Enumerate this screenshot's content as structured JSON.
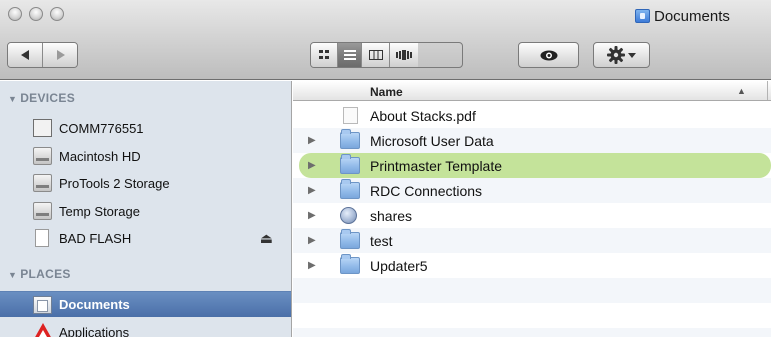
{
  "window": {
    "title": "Documents",
    "title_icon": "documents-folder-icon"
  },
  "toolbar": {
    "back_icon": "back-arrow-icon",
    "forward_icon": "forward-arrow-icon",
    "view_modes": [
      "icon-view-icon",
      "list-view-icon",
      "column-view-icon",
      "coverflow-view-icon"
    ],
    "active_view": "list-view-icon",
    "quicklook_icon": "eye-icon",
    "action_icon": "gear-icon",
    "action_dropdown_icon": "chevron-down-icon"
  },
  "sidebar": {
    "devices_heading": "DEVICES",
    "devices": [
      {
        "label": "COMM776551",
        "icon": "computer-icon"
      },
      {
        "label": "Macintosh HD",
        "icon": "hard-drive-icon"
      },
      {
        "label": "ProTools 2 Storage",
        "icon": "hard-drive-icon"
      },
      {
        "label": "Temp Storage",
        "icon": "hard-drive-icon"
      },
      {
        "label": "BAD FLASH",
        "icon": "flash-drive-icon",
        "eject_icon": "eject-icon"
      }
    ],
    "places_heading": "PLACES",
    "places": [
      {
        "label": "Documents",
        "icon": "documents-icon",
        "selected": true
      },
      {
        "label": "Applications",
        "icon": "applications-icon"
      }
    ],
    "colors": {
      "background": "#dde4ec",
      "selected": "#4a6fa8"
    }
  },
  "file_list": {
    "column_name": "Name",
    "rows": [
      {
        "name": "About Stacks.pdf",
        "icon": "pdf-document-icon",
        "expandable": false
      },
      {
        "name": "Microsoft User Data",
        "icon": "folder-icon",
        "expandable": true
      },
      {
        "name": "Printmaster Template",
        "icon": "folder-icon",
        "expandable": true,
        "label_color": "#c4e39a"
      },
      {
        "name": "RDC Connections",
        "icon": "folder-icon",
        "expandable": true
      },
      {
        "name": "shares",
        "icon": "network-share-icon",
        "expandable": true
      },
      {
        "name": "test",
        "icon": "folder-icon",
        "expandable": true
      },
      {
        "name": "Updater5",
        "icon": "folder-icon",
        "expandable": true
      }
    ]
  }
}
